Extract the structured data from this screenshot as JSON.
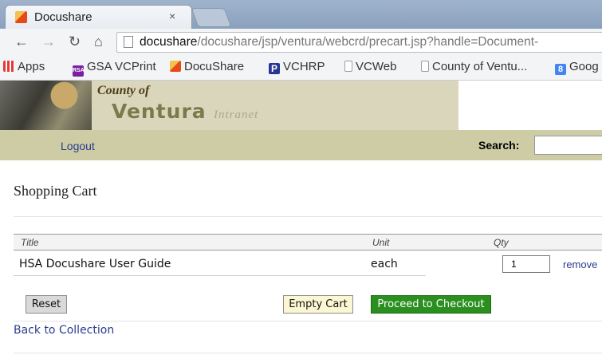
{
  "browser": {
    "tab_title": "Docushare",
    "tab_close": "×",
    "url_host": "docushare",
    "url_path": "/docushare/jsp/ventura/webcrd/precart.jsp?handle=Document-",
    "bookmarks": [
      {
        "label": "Apps",
        "icon": "apps-grid-icon",
        "color": "#e53935"
      },
      {
        "label": "GSA VCPrint",
        "icon": "rsa-icon",
        "color": "#7b1fa2",
        "badge": "RSA"
      },
      {
        "label": "DocuShare",
        "icon": "docushare-icon",
        "color": "#e64a19"
      },
      {
        "label": "VCHRP",
        "icon": "p-icon",
        "color": "#283593",
        "badge": "P"
      },
      {
        "label": "VCWeb",
        "icon": "page-icon",
        "color": "#9e9e9e"
      },
      {
        "label": "County of Ventu...",
        "icon": "page-icon",
        "color": "#9e9e9e"
      },
      {
        "label": "Goog",
        "icon": "google-icon",
        "color": "#4285f4",
        "badge": "8"
      }
    ]
  },
  "site": {
    "county_of": "County of",
    "ventura": "Ventura",
    "intranet": "Intranet",
    "logout": "Logout",
    "search_label": "Search:"
  },
  "cart": {
    "title": "Shopping Cart",
    "columns": {
      "title": "Title",
      "unit": "Unit",
      "qty": "Qty"
    },
    "items": [
      {
        "title": "HSA Docushare User Guide",
        "unit": "each",
        "qty": "1",
        "remove": "remove"
      }
    ],
    "buttons": {
      "reset": "Reset",
      "empty": "Empty Cart",
      "proceed": "Proceed to Checkout"
    },
    "back_link": "Back to Collection"
  },
  "colors": {
    "banner": "#d9d6bb",
    "subbar": "#cdcca5",
    "link": "#2b3d8f",
    "proceed": "#2a8f1f",
    "empty_cart": "#fcf7d3"
  }
}
